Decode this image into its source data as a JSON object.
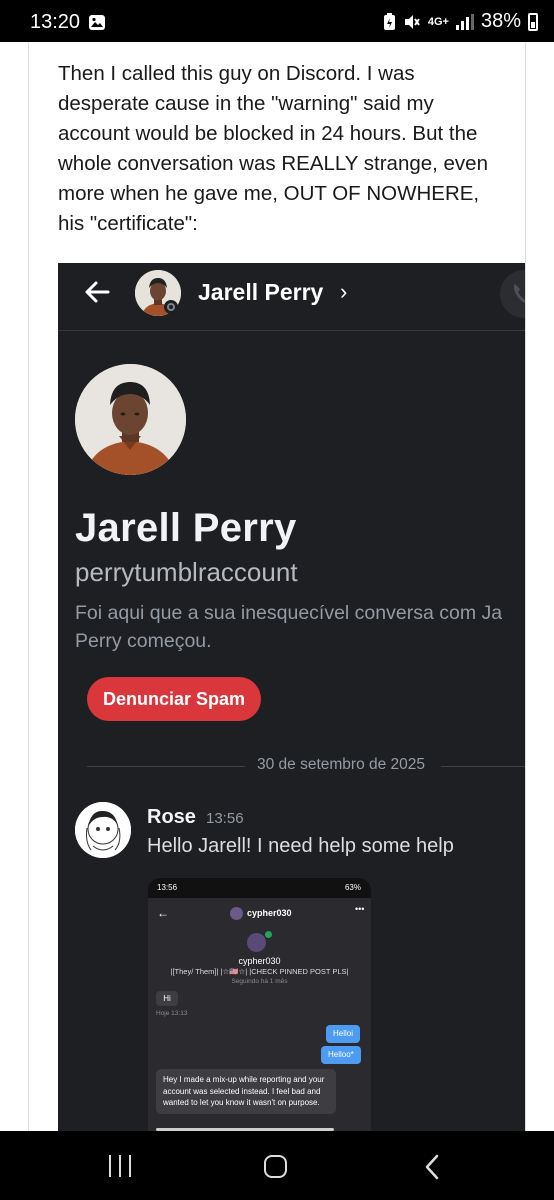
{
  "status_bar": {
    "time": "13:20",
    "network": "4G+",
    "battery": "38%",
    "icons": [
      "gallery-icon",
      "battery-saver-icon",
      "mute-icon",
      "signal-icon",
      "battery-icon"
    ]
  },
  "post": {
    "text": "Then I called this guy on Discord. I was desperate cause in the \"warning\" said my account would be blocked in 24 hours. But the whole conversation was REALLY strange, even more when he gave me, OUT OF NOWHERE, his \"certificate\":"
  },
  "discord": {
    "header": {
      "name": "Jarell Perry",
      "chevron": "›"
    },
    "profile": {
      "display_name": "Jarell Perry",
      "username": "perrytumblraccount",
      "description_line1": "Foi aqui que a sua inesquecível conversa com Ja",
      "description_line2": "Perry começou.",
      "spam_button": "Denunciar Spam"
    },
    "date_divider": "30 de setembro de 2025",
    "message": {
      "author": "Rose",
      "time": "13:56",
      "text": "Hello Jarell! I need help some help"
    },
    "embedded": {
      "status_time": "13:56",
      "status_battery": "63%",
      "header_name": "cypher030",
      "header_dots": "•••",
      "profile_name": "cypher030",
      "bio": "|[They/ Them]| |☆🇺🇸☆| |CHECK PINNED POST PLS|",
      "following": "Seguindo há 1 mês",
      "msg_hi": "Hi",
      "hoje": "Hoje 13:13",
      "out_1": "Helloi",
      "out_2": "Helloo*",
      "long_msg": "Hey I made a mix-up while reporting and your account was selected instead. I feel bad and wanted to let you know it wasn't on purpose."
    }
  },
  "colors": {
    "discord_bg": "#1e1f22",
    "spam_red": "#da373c",
    "outgoing_blue": "#4d9cf2"
  }
}
